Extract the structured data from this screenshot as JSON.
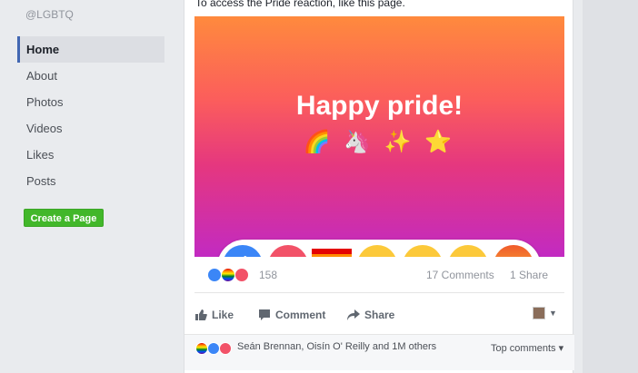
{
  "sidebar": {
    "handle": "@LGBTQ",
    "items": [
      {
        "label": "Home",
        "active": true
      },
      {
        "label": "About"
      },
      {
        "label": "Photos"
      },
      {
        "label": "Videos"
      },
      {
        "label": "Likes"
      },
      {
        "label": "Posts"
      }
    ],
    "create_page_label": "Create a Page"
  },
  "post": {
    "text": "To access the Pride reaction, like this page.",
    "image_headline": "Happy pride!",
    "image_emojis": "🌈 🦄 ✨ ⭐",
    "reactions": [
      "like",
      "love",
      "pride",
      "haha",
      "wow",
      "sad",
      "angry"
    ],
    "reaction_count": "158",
    "comments_count": "17 Comments",
    "shares_count": "1 Share"
  },
  "actions": {
    "like": "Like",
    "comment": "Comment",
    "share": "Share"
  },
  "footer": {
    "names": "Seán Brennan, Oisín O' Reilly and 1M others",
    "top_comments": "Top comments ▾"
  },
  "colors": {
    "fb_blue": "#4267b2",
    "create_green": "#42b72a",
    "gradient_top": "#ff8a3d",
    "gradient_bottom": "#c22ac2"
  }
}
